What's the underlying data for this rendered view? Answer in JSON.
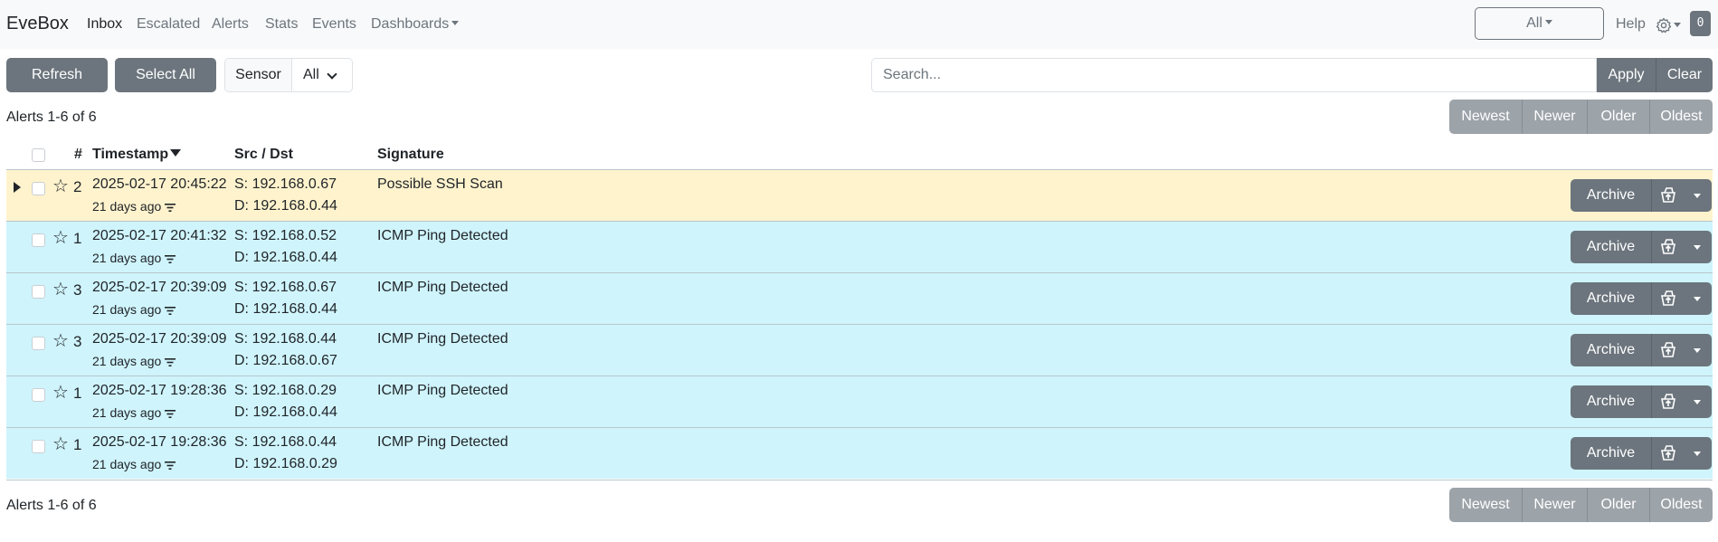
{
  "navbar": {
    "brand": "EveBox",
    "links": [
      "Inbox",
      "Escalated",
      "Alerts",
      "Stats",
      "Events"
    ],
    "dashboards_label": "Dashboards",
    "time_range": "All",
    "help": "Help",
    "badge_count": "0"
  },
  "toolbar": {
    "refresh_label": "Refresh",
    "select_all_label": "Select All",
    "sensor_label": "Sensor",
    "sensor_value": "All",
    "search_placeholder": "Search...",
    "apply_label": "Apply",
    "clear_label": "Clear"
  },
  "summary": {
    "top": "Alerts 1-6 of 6",
    "bottom": "Alerts 1-6 of 6"
  },
  "pager": {
    "newest": "Newest",
    "newer": "Newer",
    "older": "Older",
    "oldest": "Oldest"
  },
  "table": {
    "headers": {
      "count": "#",
      "timestamp": "Timestamp",
      "src_dst": "Src / Dst",
      "signature": "Signature"
    },
    "archive_label": "Archive",
    "rows": [
      {
        "count": "2",
        "timestamp": "2025-02-17 20:45:22",
        "ago": "21 days ago",
        "src": "S: 192.168.0.67",
        "dst": "D: 192.168.0.44",
        "signature": "Possible SSH Scan",
        "highlight": true
      },
      {
        "count": "1",
        "timestamp": "2025-02-17 20:41:32",
        "ago": "21 days ago",
        "src": "S: 192.168.0.52",
        "dst": "D: 192.168.0.44",
        "signature": "ICMP Ping Detected",
        "highlight": false
      },
      {
        "count": "3",
        "timestamp": "2025-02-17 20:39:09",
        "ago": "21 days ago",
        "src": "S: 192.168.0.67",
        "dst": "D: 192.168.0.44",
        "signature": "ICMP Ping Detected",
        "highlight": false
      },
      {
        "count": "3",
        "timestamp": "2025-02-17 20:39:09",
        "ago": "21 days ago",
        "src": "S: 192.168.0.44",
        "dst": "D: 192.168.0.67",
        "signature": "ICMP Ping Detected",
        "highlight": false
      },
      {
        "count": "1",
        "timestamp": "2025-02-17 19:28:36",
        "ago": "21 days ago",
        "src": "S: 192.168.0.29",
        "dst": "D: 192.168.0.44",
        "signature": "ICMP Ping Detected",
        "highlight": false
      },
      {
        "count": "1",
        "timestamp": "2025-02-17 19:28:36",
        "ago": "21 days ago",
        "src": "S: 192.168.0.44",
        "dst": "D: 192.168.0.29",
        "signature": "ICMP Ping Detected",
        "highlight": false
      }
    ]
  },
  "colors": {
    "highlight_row": "#fff3cd",
    "normal_row": "#cff4fc",
    "button": "#6c757d",
    "pager_button": "#9ca3a9"
  }
}
